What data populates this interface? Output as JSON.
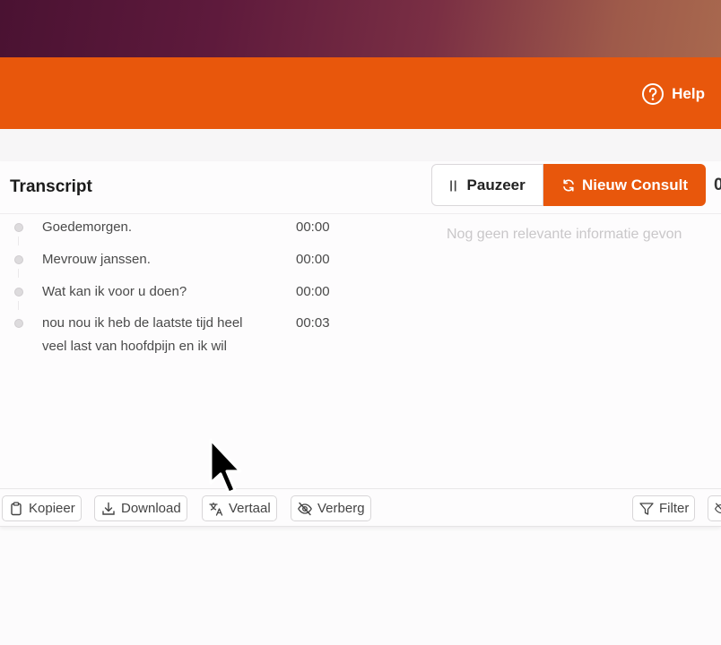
{
  "header": {
    "help_label": "Help",
    "accent_color": "#e8570c"
  },
  "transcript": {
    "title": "Transcript",
    "entries": [
      {
        "text": "Goedemorgen.",
        "time": "00:00"
      },
      {
        "text": "Mevrouw janssen.",
        "time": "00:00"
      },
      {
        "text": "Wat kan ik voor u doen?",
        "time": "00:00"
      },
      {
        "text": "nou nou ik heb de laatste tijd heel veel last van hoofdpijn en ik wil",
        "time": "00:03"
      }
    ]
  },
  "controls": {
    "pause_label": "Pauzeer",
    "new_consult_label": "Nieuw Consult",
    "timer_clip": "0"
  },
  "info_panel": {
    "empty_text": "Nog geen relevante informatie gevon"
  },
  "toolbar": {
    "copy_label": "Kopieer",
    "download_label": "Download",
    "translate_label": "Vertaal",
    "hide_label": "Verberg",
    "filter_label": "Filter"
  }
}
